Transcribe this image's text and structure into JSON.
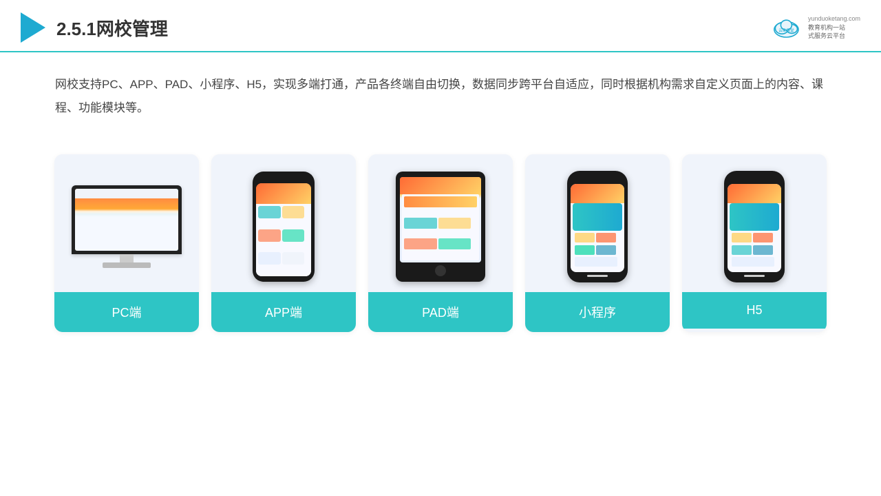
{
  "header": {
    "title": "2.5.1网校管理",
    "logo": {
      "brand": "云朵课堂",
      "domain": "yunduoketang.com",
      "tagline1": "教育机构一站",
      "tagline2": "式服务云平台"
    }
  },
  "description": {
    "text": "网校支持PC、APP、PAD、小程序、H5，实现多端打通，产品各终端自由切换，数据同步跨平台自适应，同时根据机构需求自定义页面上的内容、课程、功能模块等。"
  },
  "cards": [
    {
      "id": "pc",
      "label": "PC端"
    },
    {
      "id": "app",
      "label": "APP端"
    },
    {
      "id": "pad",
      "label": "PAD端"
    },
    {
      "id": "miniprogram",
      "label": "小程序"
    },
    {
      "id": "h5",
      "label": "H5"
    }
  ],
  "colors": {
    "accent": "#2ec5c5",
    "header_line": "#2ec5c5",
    "play_icon": "#1eaad1",
    "title": "#333333",
    "text": "#444444",
    "card_bg": "#f0f4fb"
  }
}
